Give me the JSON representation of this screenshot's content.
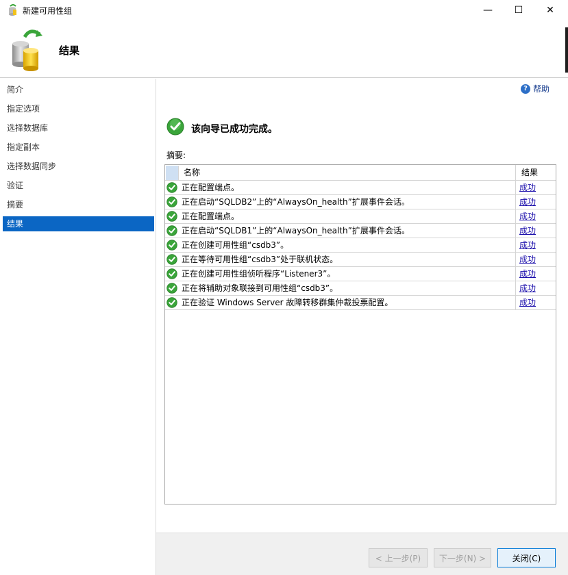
{
  "window": {
    "title": "新建可用性组",
    "minimize_glyph": "—",
    "maximize_glyph": "☐",
    "close_glyph": "✕"
  },
  "header": {
    "title": "结果",
    "icon": "availability-group-database-icon"
  },
  "nav": {
    "items": [
      {
        "label": "简介",
        "active": false
      },
      {
        "label": "指定选项",
        "active": false
      },
      {
        "label": "选择数据库",
        "active": false
      },
      {
        "label": "指定副本",
        "active": false
      },
      {
        "label": "选择数据同步",
        "active": false
      },
      {
        "label": "验证",
        "active": false
      },
      {
        "label": "摘要",
        "active": false
      },
      {
        "label": "结果",
        "active": true
      }
    ]
  },
  "main": {
    "help_label": "帮助",
    "success_message": "该向导已成功完成。",
    "summary_label": "摘要:",
    "columns": {
      "name": "名称",
      "result": "结果"
    },
    "rows": [
      {
        "message": "正在配置端点。",
        "result": "成功"
      },
      {
        "message": "正在启动“SQLDB2”上的“AlwaysOn_health”扩展事件会话。",
        "result": "成功"
      },
      {
        "message": "正在配置端点。",
        "result": "成功"
      },
      {
        "message": "正在启动“SQLDB1”上的“AlwaysOn_health”扩展事件会话。",
        "result": "成功"
      },
      {
        "message": "正在创建可用性组“csdb3”。",
        "result": "成功"
      },
      {
        "message": "正在等待可用性组“csdb3”处于联机状态。",
        "result": "成功"
      },
      {
        "message": "正在创建可用性组侦听程序“Listener3”。",
        "result": "成功"
      },
      {
        "message": "正在将辅助对象联接到可用性组“csdb3”。",
        "result": "成功"
      },
      {
        "message": "正在验证 Windows Server 故障转移群集仲裁投票配置。",
        "result": "成功"
      }
    ]
  },
  "footer": {
    "prev_label": "< 上一步(P)",
    "next_label": "下一步(N) >",
    "close_label": "关闭(C)"
  },
  "colors": {
    "accent": "#0b66c4",
    "success_green": "#3aa53a",
    "link": "#1a0dab"
  }
}
